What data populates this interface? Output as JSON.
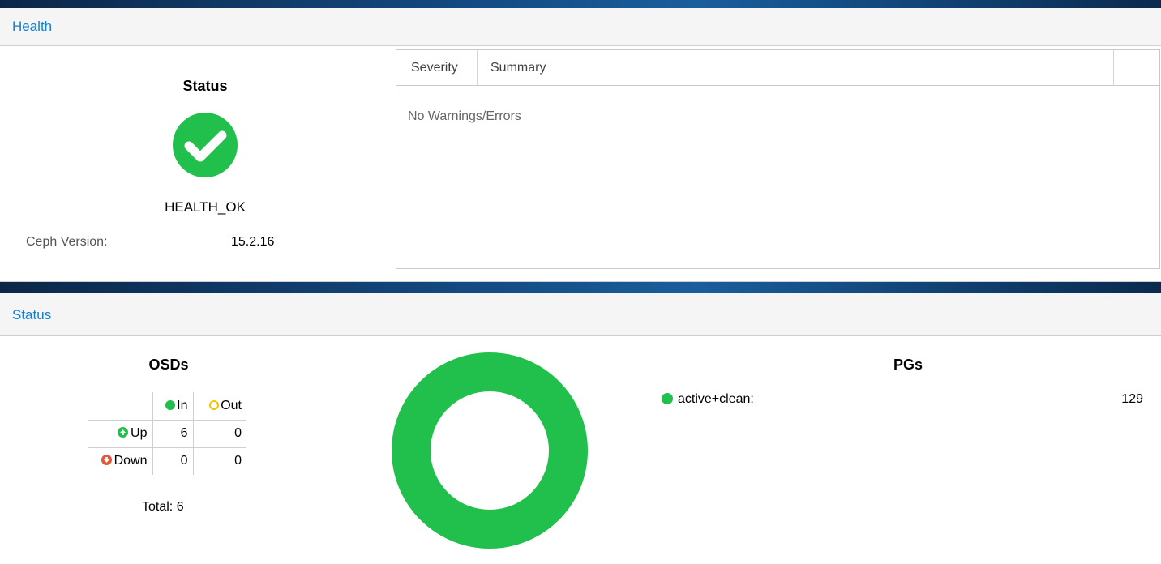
{
  "health": {
    "panel_title": "Health",
    "status_title": "Status",
    "status_text": "HEALTH_OK",
    "version_label": "Ceph Version:",
    "version_value": "15.2.16",
    "icon": "check-circle-icon",
    "status_color": "#21bf4b"
  },
  "warnings": {
    "columns": [
      "Severity",
      "Summary"
    ],
    "empty_text": "No Warnings/Errors"
  },
  "status": {
    "panel_title": "Status",
    "osds": {
      "title": "OSDs",
      "col_in": "In",
      "col_out": "Out",
      "rows": [
        {
          "label": "Up",
          "in": "6",
          "out": "0"
        },
        {
          "label": "Down",
          "in": "0",
          "out": "0"
        }
      ],
      "total": "Total: 6"
    },
    "pgs": {
      "title": "PGs",
      "items": [
        {
          "label": "active+clean:",
          "count": "129",
          "color": "#21bf4b"
        }
      ]
    }
  }
}
